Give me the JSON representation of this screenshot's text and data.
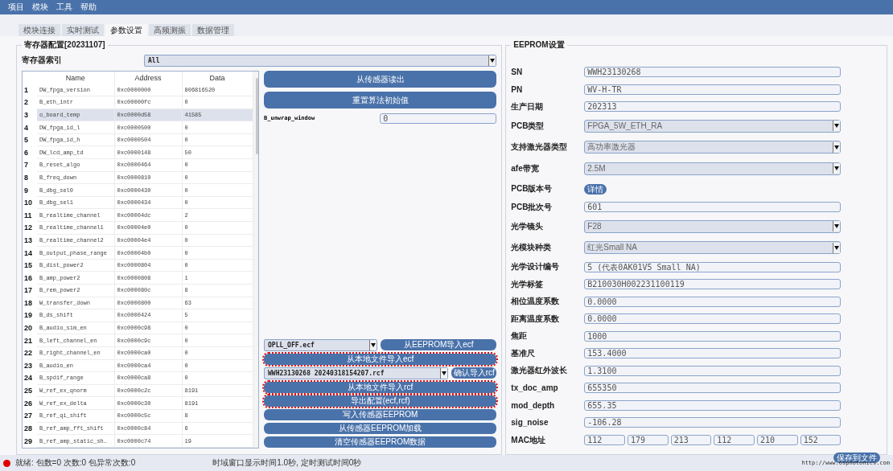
{
  "menu": [
    {
      "label": "项目"
    },
    {
      "label": "模块"
    },
    {
      "label": "工具"
    },
    {
      "label": "帮助"
    }
  ],
  "tabs": [
    {
      "label": "模块连接",
      "selected": false
    },
    {
      "label": "实时测试",
      "selected": false
    },
    {
      "label": "参数设置",
      "selected": true
    },
    {
      "label": "高频测振",
      "selected": false
    },
    {
      "label": "数据管理",
      "selected": false
    }
  ],
  "register_group": {
    "title": "寄存器配置[20231107]",
    "index_label": "寄存器索引",
    "index_select": "All",
    "table": {
      "columns": [
        "Name",
        "Address",
        "Data"
      ],
      "rows": [
        {
          "number": "1",
          "name": "DW_fpga_version",
          "address": "0xc0000000",
          "data": "806816520",
          "selected": false
        },
        {
          "number": "2",
          "name": "B_eth_intr",
          "address": "0xc00000fc",
          "data": "0",
          "selected": false
        },
        {
          "number": "3",
          "name": "o_board_temp",
          "address": "0xc0000d58",
          "data": "41585",
          "selected": true
        },
        {
          "number": "4",
          "name": "DW_fpga_id_l",
          "address": "0xc0000500",
          "data": "0",
          "selected": false
        },
        {
          "number": "5",
          "name": "DW_fpga_id_h",
          "address": "0xc0000504",
          "data": "0",
          "selected": false
        },
        {
          "number": "6",
          "name": "DW_lcd_amp_td",
          "address": "0xc0000148",
          "data": "50",
          "selected": false
        },
        {
          "number": "7",
          "name": "B_reset_algo",
          "address": "0xc0000464",
          "data": "0",
          "selected": false
        },
        {
          "number": "8",
          "name": "B_freq_down",
          "address": "0xc0000810",
          "data": "0",
          "selected": false
        },
        {
          "number": "9",
          "name": "B_dbg_sel0",
          "address": "0xc0000430",
          "data": "0",
          "selected": false
        },
        {
          "number": "10",
          "name": "B_dbg_sel1",
          "address": "0xc0000434",
          "data": "0",
          "selected": false
        },
        {
          "number": "11",
          "name": "B_realtime_channel",
          "address": "0xc00004dc",
          "data": "2",
          "selected": false
        },
        {
          "number": "12",
          "name": "B_realtime_channel1",
          "address": "0xc00004e0",
          "data": "0",
          "selected": false
        },
        {
          "number": "13",
          "name": "B_realtime_channel2",
          "address": "0xc00004e4",
          "data": "0",
          "selected": false
        },
        {
          "number": "14",
          "name": "B_output_phase_range",
          "address": "0xc00004b0",
          "data": "0",
          "selected": false
        },
        {
          "number": "15",
          "name": "B_dist_power2",
          "address": "0xc0000804",
          "data": "0",
          "selected": false
        },
        {
          "number": "16",
          "name": "B_amp_power2",
          "address": "0xc0000808",
          "data": "1",
          "selected": false
        },
        {
          "number": "17",
          "name": "B_rem_power2",
          "address": "0xc000080c",
          "data": "8",
          "selected": false
        },
        {
          "number": "18",
          "name": "W_transfer_down",
          "address": "0xc0000800",
          "data": "63",
          "selected": false
        },
        {
          "number": "19",
          "name": "B_ds_shift",
          "address": "0xc0000424",
          "data": "5",
          "selected": false
        },
        {
          "number": "20",
          "name": "B_audio_sim_en",
          "address": "0xc0000c98",
          "data": "0",
          "selected": false
        },
        {
          "number": "21",
          "name": "B_left_channel_en",
          "address": "0xc0000c9c",
          "data": "0",
          "selected": false
        },
        {
          "number": "22",
          "name": "B_right_channel_en",
          "address": "0xc0000ca0",
          "data": "0",
          "selected": false
        },
        {
          "number": "23",
          "name": "B_audio_en",
          "address": "0xc0000ca4",
          "data": "0",
          "selected": false
        },
        {
          "number": "24",
          "name": "B_spdif_range",
          "address": "0xc0000ca8",
          "data": "0",
          "selected": false
        },
        {
          "number": "25",
          "name": "W_ref_ex_qnorm",
          "address": "0xc0000c2c",
          "data": "8191",
          "selected": false
        },
        {
          "number": "26",
          "name": "W_ref_ex_delta",
          "address": "0xc0000c30",
          "data": "8191",
          "selected": false
        },
        {
          "number": "27",
          "name": "B_ref_qi_shift",
          "address": "0xc0000c5c",
          "data": "8",
          "selected": false
        },
        {
          "number": "28",
          "name": "B_ref_amp_fft_shift",
          "address": "0xc0000c84",
          "data": "6",
          "selected": false
        },
        {
          "number": "29",
          "name": "B_ref_amp_static_sh…",
          "address": "0xc0000c74",
          "data": "19",
          "selected": false
        }
      ]
    },
    "top_actions": [
      {
        "label": "从传感器读出"
      },
      {
        "label": "重置算法初始值"
      }
    ],
    "unwrap": {
      "label": "B_unwrap_window",
      "value": "0"
    },
    "bottom_actions": [
      {
        "kind": "combo",
        "value": "OPLL_OFF.ecf",
        "button": "从EEPROM导入ecf",
        "wide": false
      },
      {
        "kind": "button",
        "label": "从本地文件导入ecf",
        "highlighted": true
      },
      {
        "kind": "combo",
        "value": "WWH23130268 20240318154207.rcf",
        "button": "确认导入rcf",
        "wide": true
      },
      {
        "kind": "button",
        "label": "从本地文件导入rcf",
        "highlighted": true
      },
      {
        "kind": "button",
        "label": "导出配置(ecf,rcf)",
        "highlighted": true
      },
      {
        "kind": "button",
        "label": "写入传感器EEPROM",
        "highlighted": false
      },
      {
        "kind": "button",
        "label": "从传感器EEPROM加载",
        "highlighted": false
      },
      {
        "kind": "button",
        "label": "清空传感器EEPROM数据",
        "highlighted": false
      }
    ]
  },
  "eeprom_group": {
    "title": "EEPROM设置",
    "fields": [
      {
        "kind": "text",
        "label": "SN",
        "value": "WWH23130268"
      },
      {
        "kind": "text",
        "label": "PN",
        "value": "WV-H-TR"
      },
      {
        "kind": "text",
        "label": "生产日期",
        "value": "202313"
      },
      {
        "kind": "select",
        "label": "PCB类型",
        "value": "FPGA_5W_ETH_RA"
      },
      {
        "kind": "select",
        "label": "支持激光器类型",
        "value": "高功率激光器"
      },
      {
        "kind": "select",
        "label": "afe带宽",
        "value": "2.5M"
      },
      {
        "kind": "button",
        "label": "PCB版本号",
        "value": "详情"
      },
      {
        "kind": "text",
        "label": "PCB批次号",
        "value": "601"
      },
      {
        "kind": "select",
        "label": "光学镜头",
        "value": "F28"
      },
      {
        "kind": "select",
        "label": "光模块种类",
        "value": "红光Small NA"
      },
      {
        "kind": "text",
        "label": "光学设计编号",
        "value": "5 (代表0AK01V5 Small NA)"
      },
      {
        "kind": "text",
        "label": "光学标签",
        "value": "B210030H002231100119"
      },
      {
        "kind": "text",
        "label": "相位温度系数",
        "value": "0.0000"
      },
      {
        "kind": "text",
        "label": "距离温度系数",
        "value": "0.0000"
      },
      {
        "kind": "text",
        "label": "焦距",
        "value": "1000"
      },
      {
        "kind": "text",
        "label": "基准尺",
        "value": "153.4000"
      },
      {
        "kind": "text",
        "label": "激光器红外波长",
        "value": "1.3100"
      },
      {
        "kind": "text",
        "label": "tx_doc_amp",
        "value": "655350"
      },
      {
        "kind": "text",
        "label": "mod_depth",
        "value": "655.35"
      },
      {
        "kind": "text",
        "label": "sig_noise",
        "value": "-106.28"
      },
      {
        "kind": "mac",
        "label": "MAC地址",
        "values": [
          "112",
          "179",
          "213",
          "112",
          "210",
          "152"
        ]
      }
    ],
    "save_button": "保存到文件"
  },
  "status_bar": {
    "state": "就绪: 包数=0 次数:0 包异常次数:0",
    "timing": "时域窗口显示时间1.0秒, 定时测试时间0秒",
    "url": "http://www.osphotonics.com"
  }
}
